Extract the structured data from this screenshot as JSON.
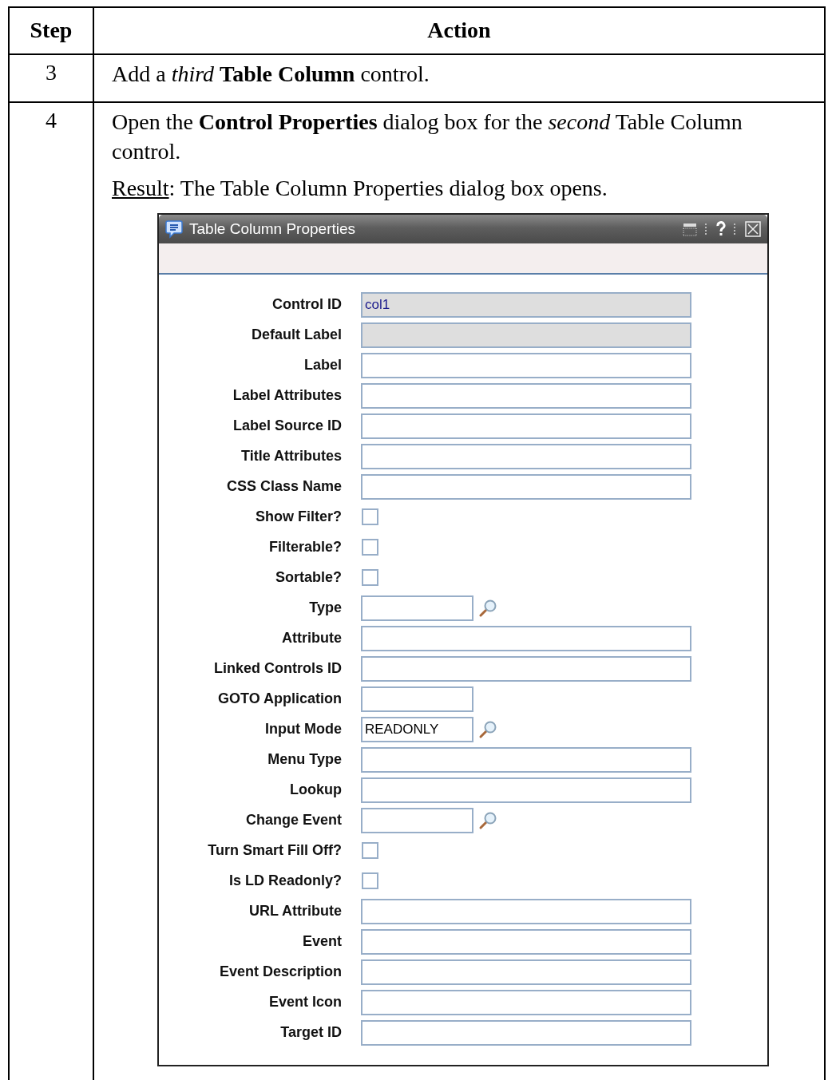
{
  "table": {
    "columns": [
      "Step",
      "Action"
    ],
    "rows": [
      {
        "step": "3",
        "paragraphs": [
          "Add a *third* **Table Column** control."
        ]
      },
      {
        "step": "4",
        "paragraphs": [
          "Open the **Control Properties** dialog box for the *second* Table Column control."
        ],
        "result": {
          "label": "Result",
          "text": ": The Table Column Properties dialog box opens."
        },
        "dialog": {
          "title": "Table Column Properties",
          "fields": [
            {
              "label": "Control ID",
              "kind": "text",
              "value": "col1",
              "disabled": true
            },
            {
              "label": "Default Label",
              "kind": "text",
              "disabled": true
            },
            {
              "label": "Label",
              "kind": "text",
              "disabled": false
            },
            {
              "label": "Label Attributes",
              "kind": "text",
              "disabled": false
            },
            {
              "label": "Label Source ID",
              "kind": "text",
              "disabled": false
            },
            {
              "label": "Title Attributes",
              "kind": "text",
              "disabled": false
            },
            {
              "label": "CSS Class Name",
              "kind": "text",
              "disabled": false
            },
            {
              "label": "Show Filter?",
              "kind": "checkbox",
              "checked": false
            },
            {
              "label": "Filterable?",
              "kind": "checkbox",
              "checked": false
            },
            {
              "label": "Sortable?",
              "kind": "checkbox",
              "checked": false
            },
            {
              "label": "Type",
              "kind": "lookup",
              "disabled": false
            },
            {
              "label": "Attribute",
              "kind": "text",
              "disabled": false
            },
            {
              "label": "Linked Controls ID",
              "kind": "text",
              "disabled": false
            },
            {
              "label": "GOTO Application",
              "kind": "short",
              "disabled": false
            },
            {
              "label": "Input Mode",
              "kind": "lookup",
              "value": "READONLY",
              "disabled": false
            },
            {
              "label": "Menu Type",
              "kind": "text",
              "disabled": false
            },
            {
              "label": "Lookup",
              "kind": "text",
              "disabled": false
            },
            {
              "label": "Change Event",
              "kind": "lookup",
              "disabled": false
            },
            {
              "label": "Turn Smart Fill Off?",
              "kind": "checkbox",
              "checked": false
            },
            {
              "label": "Is LD Readonly?",
              "kind": "checkbox",
              "checked": false
            },
            {
              "label": "URL Attribute",
              "kind": "text",
              "disabled": false
            },
            {
              "label": "Event",
              "kind": "text",
              "disabled": false
            },
            {
              "label": "Event Description",
              "kind": "text",
              "disabled": false
            },
            {
              "label": "Event Icon",
              "kind": "text",
              "disabled": false
            },
            {
              "label": "Target ID",
              "kind": "text",
              "disabled": false
            }
          ]
        }
      }
    ]
  }
}
